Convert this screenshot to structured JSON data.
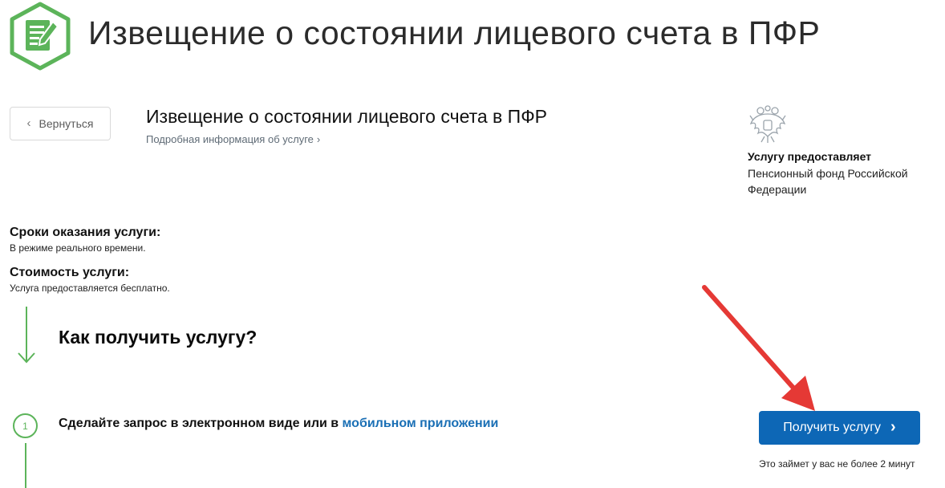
{
  "header": {
    "logo_icon": "form-edit-icon",
    "title": "Извещение о состоянии лицевого счета в ПФР"
  },
  "back_button": {
    "label": "Вернуться",
    "icon": "chevron-left-icon"
  },
  "service": {
    "title": "Извещение о состоянии лицевого счета в ПФР",
    "more_info": "Подробная информация об услуге",
    "more_icon": "chevron-right-icon"
  },
  "provider": {
    "emblem_icon": "coat-of-arms-icon",
    "label": "Услугу предоставляет",
    "name": "Пенсионный фонд Российской Федерации"
  },
  "terms": {
    "label": "Сроки оказания услуги:",
    "value": "В режиме реального времени."
  },
  "cost": {
    "label": "Стоимость услуги:",
    "value": "Услуга предоставляется бесплатно."
  },
  "how": {
    "title": "Как получить услугу?",
    "arrow_icon": "arrow-down-icon"
  },
  "step1": {
    "number": "1",
    "text": "Сделайте запрос в электронном виде или в",
    "link": "мобильном приложении"
  },
  "cta": {
    "label": "Получить услугу",
    "icon": "chevron-right-icon",
    "note": "Это займет у вас не более 2 минут"
  },
  "colors": {
    "accent_green": "#5cb45a",
    "primary_blue": "#0d67b6",
    "link_blue": "#1a6fb5",
    "annotation_red": "#e53935"
  }
}
